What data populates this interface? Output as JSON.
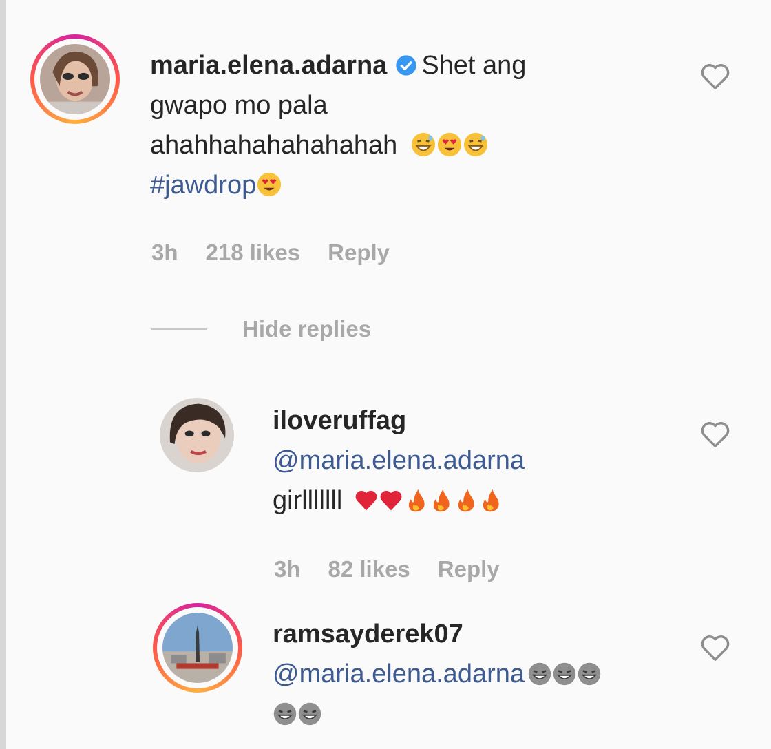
{
  "comments": [
    {
      "username": "maria.elena.adarna",
      "verified": true,
      "text_line1": "Shet ang",
      "text_line2": "gwapo mo pala",
      "text_line3": "ahahhahahahahahah",
      "hashtag": "#jawdrop",
      "time": "3h",
      "likes": "218 likes",
      "reply": "Reply",
      "emojis": [
        "grinning-sweat-emoji",
        "heart-eyes-emoji",
        "grinning-sweat-emoji",
        "heart-eyes-emoji"
      ]
    }
  ],
  "hide_replies": "Hide replies",
  "replies": [
    {
      "username": "iloveruffag",
      "mention": "@maria.elena.adarna",
      "text": "girlllllll",
      "time": "3h",
      "likes": "82 likes",
      "reply": "Reply",
      "emojis": [
        "red-heart-emoji",
        "red-heart-emoji",
        "fire-emoji",
        "fire-emoji",
        "fire-emoji",
        "fire-emoji"
      ]
    },
    {
      "username": "ramsayderek07",
      "mention": "@maria.elena.adarna",
      "emojis": [
        "laughing-emoji",
        "laughing-emoji",
        "laughing-emoji",
        "laughing-emoji",
        "laughing-emoji"
      ]
    }
  ],
  "colors": {
    "background": "#fafafa",
    "mention": "#3d5a91",
    "meta": "#a8a8a8",
    "verified": "#3897f0"
  }
}
